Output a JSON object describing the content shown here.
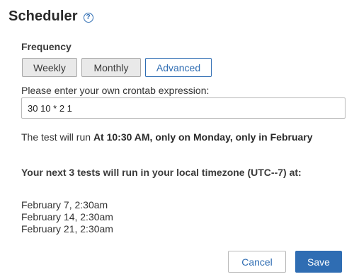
{
  "header": {
    "title": "Scheduler",
    "help_icon": "question-circle-icon",
    "help_glyph": "?"
  },
  "frequency": {
    "label": "Frequency",
    "options": [
      {
        "label": "Weekly",
        "selected": false
      },
      {
        "label": "Monthly",
        "selected": false
      },
      {
        "label": "Advanced",
        "selected": true
      }
    ]
  },
  "crontab": {
    "label": "Please enter your own crontab expression:",
    "value": "30 10 * 2 1"
  },
  "schedule_description": {
    "prefix": "The test will run ",
    "summary": "At 10:30 AM, only on Monday, only in February"
  },
  "next_runs": {
    "heading": "Your next 3 tests will run in your local timezone (UTC--7) at:",
    "items": [
      "February 7, 2:30am",
      "February 14, 2:30am",
      "February 21, 2:30am"
    ]
  },
  "actions": {
    "cancel_label": "Cancel",
    "save_label": "Save"
  },
  "colors": {
    "accent": "#2f6db3",
    "text": "#333333",
    "button_inactive_bg": "#e9e9e9"
  }
}
